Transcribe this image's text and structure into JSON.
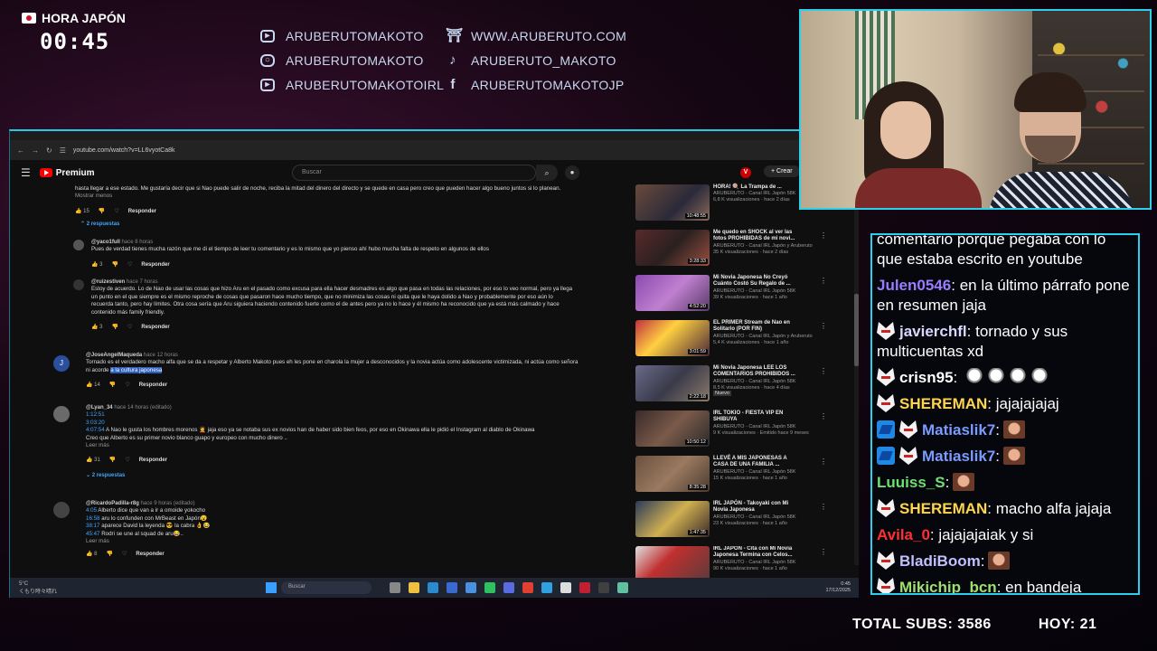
{
  "overlay": {
    "clock_label": "HORA JAPÓN",
    "clock_time": "00:45",
    "socials_left": [
      {
        "icon": "youtube-icon",
        "text": "ARUBERUTOMAKOTO"
      },
      {
        "icon": "instagram-icon",
        "text": "ARUBERUTOMAKOTO"
      },
      {
        "icon": "youtube-icon",
        "text": "ARUBERUTOMAKOTOIRL"
      }
    ],
    "socials_right": [
      {
        "icon": "torii-icon",
        "text": "WWW.ARUBERUTO.COM"
      },
      {
        "icon": "tiktok-icon",
        "text": "ARUBERUTO_MAKOTO"
      },
      {
        "icon": "facebook-icon",
        "text": "ARUBERUTOMAKOTOJP"
      }
    ],
    "total_subs": "TOTAL SUBS: 3586",
    "hoy": "HOY: 21",
    "accent_color": "#2ad0ec"
  },
  "browser": {
    "url": "youtube.com/watch?v=LL6vyotCa8k",
    "youtube": {
      "logo": "Premium",
      "search_placeholder": "Buscar",
      "create": "Crear"
    },
    "comments": [
      {
        "text": "hasta llegar a ese estado. Me gustaría decir que si Nao puede salir de noche, reciba la mitad del dinero del directo y se quede en casa pero creo que pueden hacer algo bueno juntos si lo planean.",
        "more": "Mostrar menos",
        "likes": "15",
        "reply": "Responder",
        "replies": "2 respuestas"
      },
      {
        "author": "@yaco1full",
        "time": "hace 8 horas",
        "text": "Pues de verdad tienes mucha razón que me di el tiempo de leer tu comentario y es lo mismo que yo pienso  ahí hubo mucha falta de respeto en algunos de ellos",
        "likes": "3",
        "reply": "Responder"
      },
      {
        "author": "@ruizestiven",
        "time": "hace 7 horas",
        "text1": "Estoy de acuerdo. Lo de Nao de usar las cosas que hizo Aru en el pasado como excusa para ella hacer desmadres es algo que pasa en todas las relaciones, por eso lo veo normal, pero ya llega",
        "text2": "un punto en el que siempre es el mismo reproche de cosas que pasaron hace mucho tiempo, que no minimiza las cosas ni quita que le haya dolido a Nao y probablemente por eso aún lo",
        "text3": "recuerda tanto, pero hay límites. Otra cosa sería que Aru siguiera haciendo contenido fuerte como el de antes pero ya no lo hace y él mismo ha reconocido que ya está más calmado y hace",
        "text4": "contenido más family friendly.",
        "likes": "3",
        "reply": "Responder"
      },
      {
        "avatar": "J",
        "author": "@JoseAngelMaqueda",
        "time": "hace 12 horas",
        "text1": "Tornado es el verdadero macho alfa que se da a respetar y Alberto Makoto pues eh les pone en charola la mujer a desconocidos y la novia actúa como adolescente victimizada, ni actúa como señora",
        "text2a": "ni acorde ",
        "text2b": "a la cultura japonesa",
        "likes": "14",
        "reply": "Responder"
      },
      {
        "author": "@Lyan_34",
        "time": "hace 14 horas (editado)",
        "ts1": "1:12:51",
        "ts2": "3:03:20",
        "ts3": "4:07:54",
        "text1": " A Nao le gusta los hombres morenos 🤦 jaja eso ya se notaba sus ex novios han de haber sido bien feos, por eso en Okinawa ella le pidió el Instagram al diablo de Okinawa",
        "text2": "Creo que Alberto es su primer novio blanco guapo y europeo con mucho dinero ..",
        "more": "Leer más",
        "likes": "31",
        "reply": "Responder",
        "replies": "2 respuestas"
      },
      {
        "author": "@RicardoPadilla-r8g",
        "time": "hace 9 horas (editado)",
        "ts1": "4:05",
        "t1": " Alberto dice que van a ir a omoide yokocho",
        "ts2": "16:58",
        "t2": " aru lo confunden con MrBeast en Japón😮",
        "ts3": "38:17",
        "t3": " aparece David la leyenda 😎 la cabra 👌😂",
        "ts4": "45:47",
        "t4": " Rodri se une al squad de aru😂..",
        "more": "Leer más",
        "likes": "8",
        "reply": "Responder"
      }
    ],
    "videos": [
      {
        "title1": "HORA! 🍭 La Trampa de ...",
        "channel": "ARUBERUTO - Canal IRL Japón",
        "subs": "58K",
        "stats": "6,8 K visualizaciones · hace 2 días",
        "duration": "10:48:55"
      },
      {
        "title1": "Me quedo en SHOCK al ver las",
        "title2": "fotos PROHIBIDAS de mi novi...",
        "channel": "ARUBERUTO - Canal IRL Japón y Aruberuto",
        "stats": "35 K visualizaciones · hace 2 días",
        "duration": "3:28:33"
      },
      {
        "title1": "Mi Novia Japonesa No Creyó",
        "title2": "Cuánto Costó Su Regalo de ...",
        "channel": "ARUBERUTO - Canal IRL Japón",
        "subs": "58K",
        "stats": "39 K visualizaciones · hace 1 año",
        "duration": "4:52:20"
      },
      {
        "title1": "EL PRIMER Stream de Nao en",
        "title2": "Solitario (POR FIN)",
        "channel": "ARUBERUTO - Canal IRL Japón y Aruberuto",
        "stats": "5,4 K visualizaciones · hace 1 año",
        "duration": "3:01:59"
      },
      {
        "title1": "Mi Novia Japonesa LEE LOS",
        "title2": "COMENTARIOS PROHIBIDOS ...",
        "channel": "ARUBERUTO - Canal IRL Japón",
        "subs": "58K",
        "stats": "8,5 K visualizaciones · hace 4 días",
        "badge": "Nuevo",
        "duration": "2:22:18"
      },
      {
        "title1": "IRL TOKIO - FIESTA VIP EN",
        "title2": "SHIBUYA",
        "channel": "ARUBERUTO - Canal IRL Japón",
        "subs": "58K",
        "stats": "9 K visualizaciones · Emitido hace 9 meses",
        "duration": "10:50:12"
      },
      {
        "title1": "LLEVÉ A MIS JAPONESAS A",
        "title2": "CASA DE UNA FAMILIA ...",
        "channel": "ARUBERUTO - Canal IRL Japón",
        "subs": "58K",
        "stats": "15 K visualizaciones · hace 1 año",
        "duration": "8:35:28"
      },
      {
        "title1": "IRL JAPÓN - Takoyaki con Mi",
        "title2": "Novia Japonesa",
        "channel": "ARUBERUTO - Canal IRL Japón",
        "subs": "58K",
        "stats": "23 K visualizaciones · hace 1 año",
        "duration": "1:47:35"
      },
      {
        "title1": "IRL JAPÓN - Cita con Mi Novia",
        "title2": "Japonesa Termina con Celos...",
        "channel": "ARUBERUTO - Canal IRL Japón",
        "subs": "58K",
        "stats": "90 K visualizaciones · hace 1 año"
      }
    ],
    "taskbar": {
      "weather_temp": "5°C",
      "weather_desc": "くもり時々晴れ",
      "search_placeholder": "Buscar",
      "time": "0:45",
      "date": "17/12/2025"
    }
  },
  "chat": {
    "messages": [
      {
        "text1": "comentario porque pegaba con lo",
        "text2": "que estaba escrito en youtube"
      },
      {
        "user": "Julen0546",
        "color": "#9a7cff",
        "text": " en la último párrafo pone en resumen jaja"
      },
      {
        "user": "javierchfl",
        "badge": "fox",
        "color": "#d8d8ff",
        "text": " tornado y sus multicuentas xd"
      },
      {
        "user": "crisn95",
        "badge": "fox",
        "color": "#ffffff",
        "emotes": "ghost"
      },
      {
        "user": "SHEREMAN",
        "badge": "fox",
        "color": "#ffd54a",
        "text": " jajajajajaj"
      },
      {
        "user": "Matiaslik7",
        "badge": "fox2",
        "color": "#7a9cff",
        "emotes": "face"
      },
      {
        "user": "Matiaslik7",
        "badge": "fox2",
        "color": "#7a9cff",
        "emotes": "face"
      },
      {
        "user": "Luuiss_S",
        "color": "#6ee06e",
        "emotes": "face"
      },
      {
        "user": "SHEREMAN",
        "badge": "fox",
        "color": "#ffd54a",
        "text": " macho alfa jajaja"
      },
      {
        "user": "Avila_0",
        "color": "#ff3030",
        "text": " jajajajaiak y si"
      },
      {
        "user": "BladiBoom",
        "badge": "fox",
        "color": "#c0c0ff",
        "emotes": "face"
      },
      {
        "user": "Mikichip_bcn",
        "badge": "fox",
        "color": "#9de070",
        "text": " en bandeja"
      }
    ]
  }
}
